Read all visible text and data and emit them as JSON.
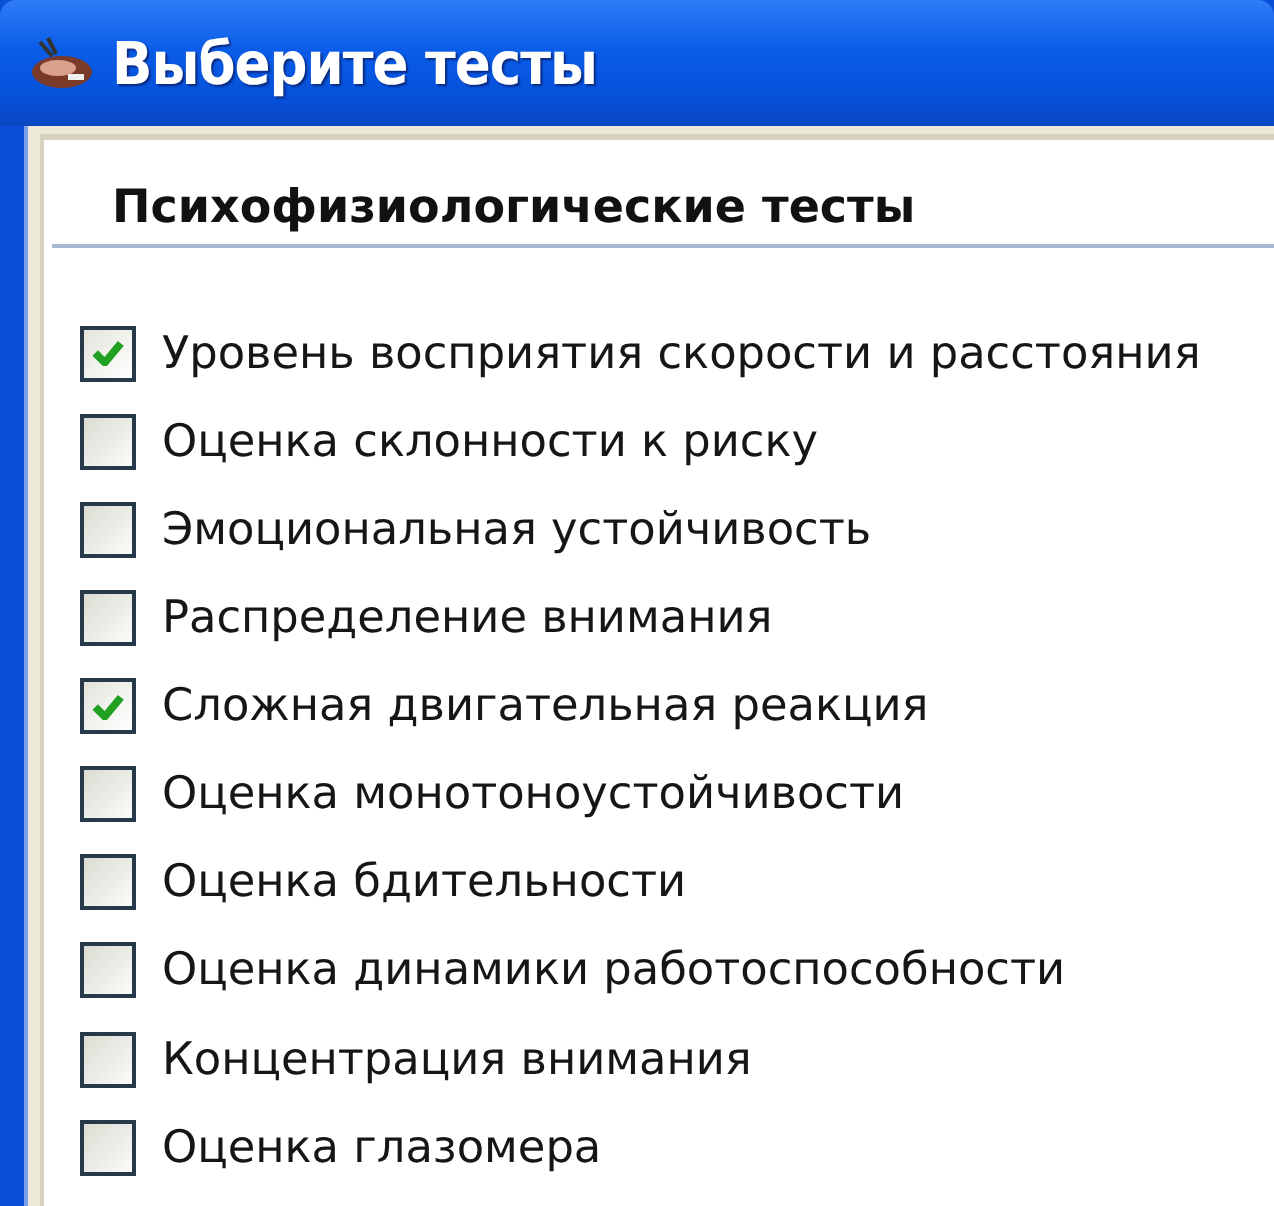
{
  "window": {
    "title": "Выберите тесты"
  },
  "section": {
    "title": "Психофизиологические тесты"
  },
  "tests": [
    {
      "label": "Уровень восприятия скорости и расстояния",
      "checked": true
    },
    {
      "label": "Оценка склонности к риску",
      "checked": false
    },
    {
      "label": "Эмоциональная устойчивость",
      "checked": false
    },
    {
      "label": "Распределение внимания",
      "checked": false
    },
    {
      "label": "Сложная двигательная реакция",
      "checked": true
    },
    {
      "label": "Оценка монотоноустойчивости",
      "checked": false
    },
    {
      "label": "Оценка бдительности",
      "checked": false
    },
    {
      "label": "Оценка динамики работоспособности",
      "checked": false
    },
    {
      "label": "Концентрация внимания",
      "checked": false
    },
    {
      "label": "Оценка глазомера",
      "checked": false
    }
  ]
}
